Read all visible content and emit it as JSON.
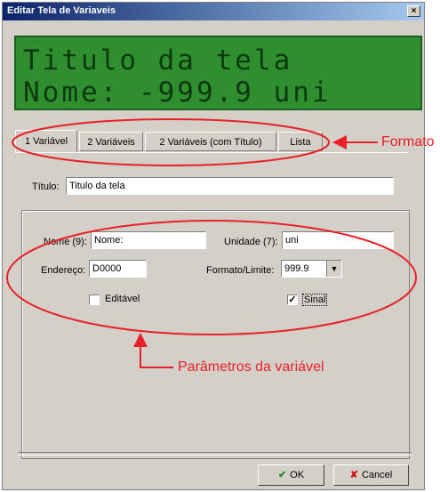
{
  "window": {
    "title": "Editar Tela de Variaveis",
    "close_glyph": "×"
  },
  "lcd": {
    "line1": "Titulo da tela",
    "line2": "Nome: -999.9 uni"
  },
  "tabs": [
    {
      "label": "1 Variável",
      "active": true
    },
    {
      "label": "2 Variáveis",
      "active": false
    },
    {
      "label": "2 Variáveis (com Título)",
      "active": false
    },
    {
      "label": "Lista",
      "active": false
    }
  ],
  "title_field": {
    "label": "Título:",
    "value": "Titulo da tela"
  },
  "params": {
    "nome": {
      "label": "Nome (9):",
      "value": "Nome:"
    },
    "unidade": {
      "label": "Unidade (7):",
      "value": "uni"
    },
    "endereco": {
      "label": "Endereço:",
      "value": "D0000"
    },
    "formato": {
      "label": "Formato/Limite:",
      "value": "999.9"
    },
    "editavel": {
      "label": "Editável",
      "checked": false
    },
    "sinal": {
      "label": "Sinal",
      "checked": true
    }
  },
  "buttons": {
    "ok": "OK",
    "cancel": "Cancel"
  },
  "annotations": {
    "formato": "Formato",
    "parametros": "Parâmetros da variável",
    "color": "#e8202a"
  }
}
